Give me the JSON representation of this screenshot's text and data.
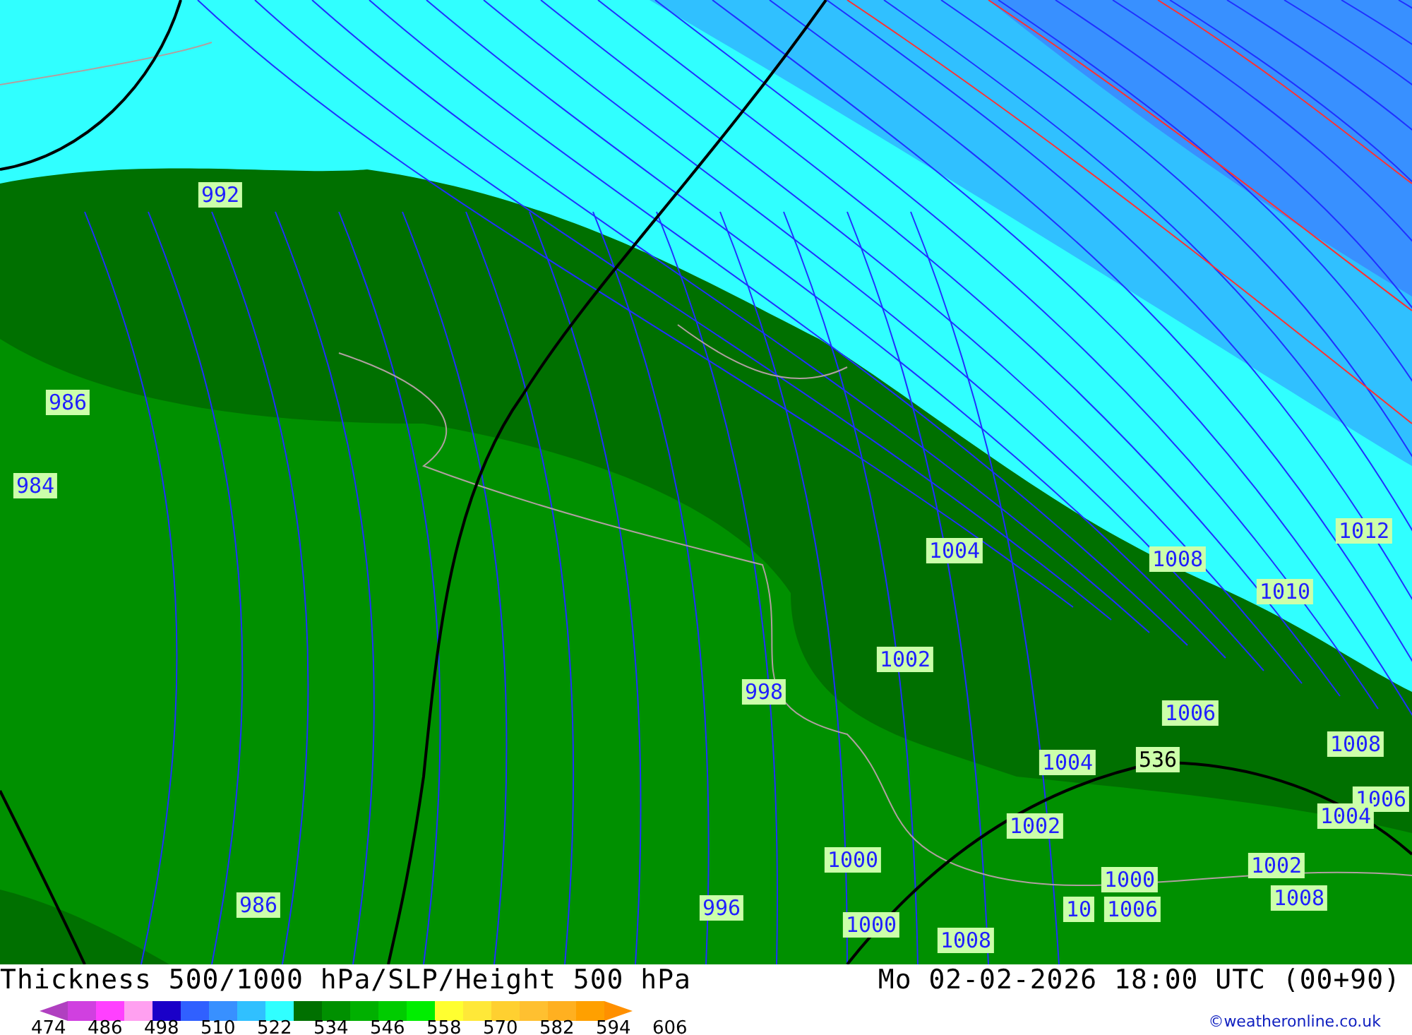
{
  "map": {
    "labels": [
      {
        "kind": "isobar",
        "text": "992"
      },
      {
        "kind": "isobar",
        "text": "986"
      },
      {
        "kind": "isobar",
        "text": "984"
      },
      {
        "kind": "isobar",
        "text": "1004"
      },
      {
        "kind": "isobar",
        "text": "1008"
      },
      {
        "kind": "isobar",
        "text": "1012"
      },
      {
        "kind": "isobar",
        "text": "1010"
      },
      {
        "kind": "isobar",
        "text": "1002"
      },
      {
        "kind": "isobar",
        "text": "998"
      },
      {
        "kind": "isobar",
        "text": "1006"
      },
      {
        "kind": "isobar",
        "text": "1008"
      },
      {
        "kind": "isobar",
        "text": "1004"
      },
      {
        "kind": "height",
        "text": "536"
      },
      {
        "kind": "isobar",
        "text": "1006"
      },
      {
        "kind": "isobar",
        "text": "1004"
      },
      {
        "kind": "isobar",
        "text": "1002"
      },
      {
        "kind": "isobar",
        "text": "1000"
      },
      {
        "kind": "isobar",
        "text": "1002"
      },
      {
        "kind": "isobar",
        "text": "1000"
      },
      {
        "kind": "isobar",
        "text": "1008"
      },
      {
        "kind": "isobar",
        "text": "986"
      },
      {
        "kind": "isobar",
        "text": "996"
      },
      {
        "kind": "isobar",
        "text": "10"
      },
      {
        "kind": "isobar",
        "text": "1006"
      },
      {
        "kind": "isobar",
        "text": "1000"
      },
      {
        "kind": "isobar",
        "text": "1008"
      }
    ]
  },
  "title": "Thickness 500/1000 hPa/SLP/Height 500 hPa",
  "valid_time": "Mo 02-02-2026 18:00 UTC (00+90)",
  "legend": {
    "swatches": [
      {
        "color": "#b040c0"
      },
      {
        "color": "#d040e0"
      },
      {
        "color": "#ff40ff"
      },
      {
        "color": "#ffa0f0"
      },
      {
        "color": "#1a00c8"
      },
      {
        "color": "#3060ff"
      },
      {
        "color": "#3890ff"
      },
      {
        "color": "#30c0ff"
      },
      {
        "color": "#30ffff"
      },
      {
        "color": "#007000"
      },
      {
        "color": "#009000"
      },
      {
        "color": "#00b000"
      },
      {
        "color": "#00cc00"
      },
      {
        "color": "#00ee00"
      },
      {
        "color": "#ffff30"
      },
      {
        "color": "#ffe838"
      },
      {
        "color": "#ffd030"
      },
      {
        "color": "#ffc030"
      },
      {
        "color": "#ffb020"
      },
      {
        "color": "#ffa000"
      },
      {
        "color": "#ff9000"
      }
    ],
    "ticks": [
      "474",
      "486",
      "498",
      "510",
      "522",
      "534",
      "546",
      "558",
      "570",
      "582",
      "594",
      "606"
    ]
  },
  "credit": "©weatheronline.co.uk"
}
